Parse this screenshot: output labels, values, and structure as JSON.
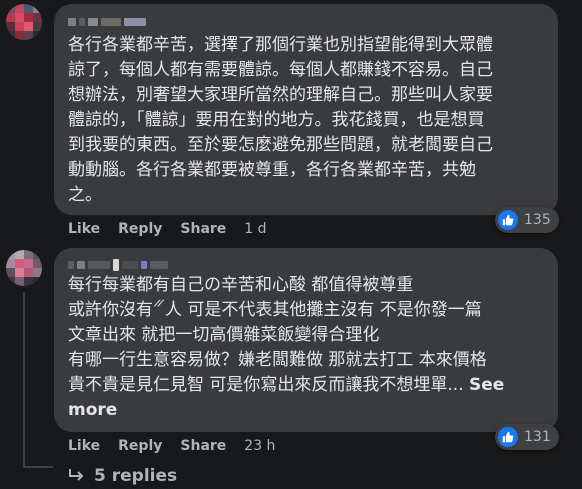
{
  "comments": [
    {
      "text": "各行各業都辛苦，選擇了那個行業也別指望能得到大眾體\n諒了，每個人都有需要體諒。每個人都賺錢不容易。自己\n想辦法，別奢望大家理所當然的理解自己。那些叫人家要\n體諒的，「體諒」要用在對的地方。我花錢買，也是想買\n到我要的東西。至於要怎麼避免那些問題，就老闆要自己\n動動腦。各行各業都要被尊重，各行各業都辛苦，共勉\n之。",
      "like_label": "Like",
      "reply_label": "Reply",
      "share_label": "Share",
      "time": "1 d",
      "reaction_count": "135"
    },
    {
      "text": "每行每業都有自己の辛苦和心酸 都值得被尊重\n或許你沒有𝄓人 可是不代表其他攤主沒有 不是你發一篇\n文章出來 就把一切高價雜菜飯變得合理化\n有哪一行生意容易做？嫌老闆難做 那就去打工 本來價格\n貴不貴是見仁見智 可是你寫出來反而讓我不想埋單... ",
      "see_more": "See\nmore",
      "like_label": "Like",
      "reply_label": "Reply",
      "share_label": "Share",
      "time": "23 h",
      "reaction_count": "131"
    }
  ],
  "replies_link": "5 replies",
  "colors": {
    "background": "#18191a",
    "bubble": "#3a3b3c",
    "text": "#e4e6eb",
    "muted": "#b0b3b8",
    "like_blue": "#1877f2"
  },
  "icons": {
    "reaction": "thumbs-up-icon",
    "replies": "reply-arrow-icon"
  }
}
